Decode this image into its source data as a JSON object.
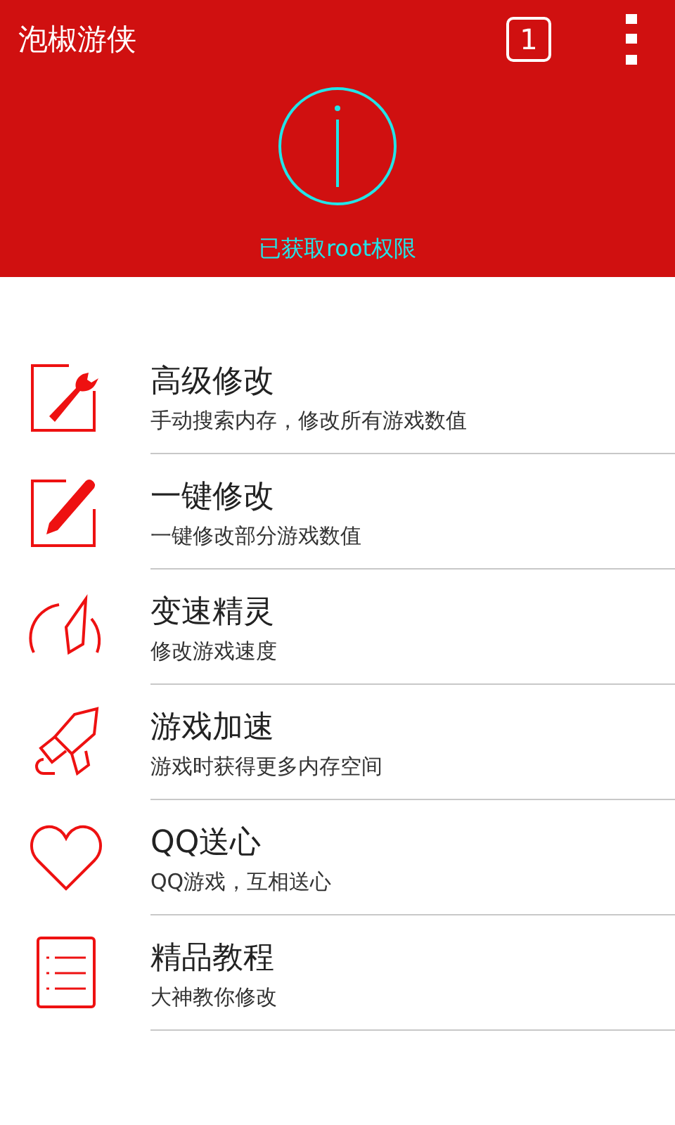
{
  "app_bar": {
    "title": "泡椒游侠",
    "badge": "1"
  },
  "status": {
    "text": "已获取root权限"
  },
  "menu": [
    {
      "kind": "wrench",
      "title": "高级修改",
      "subtitle": "手动搜索内存，修改所有游戏数值"
    },
    {
      "kind": "pencil",
      "title": "一键修改",
      "subtitle": "一键修改部分游戏数值"
    },
    {
      "kind": "gauge",
      "title": "变速精灵",
      "subtitle": "修改游戏速度"
    },
    {
      "kind": "rocket",
      "title": "游戏加速",
      "subtitle": "游戏时获得更多内存空间"
    },
    {
      "kind": "heart",
      "title": "QQ送心",
      "subtitle": "QQ游戏，互相送心"
    },
    {
      "kind": "list",
      "title": "精品教程",
      "subtitle": "大神教你修改"
    }
  ]
}
